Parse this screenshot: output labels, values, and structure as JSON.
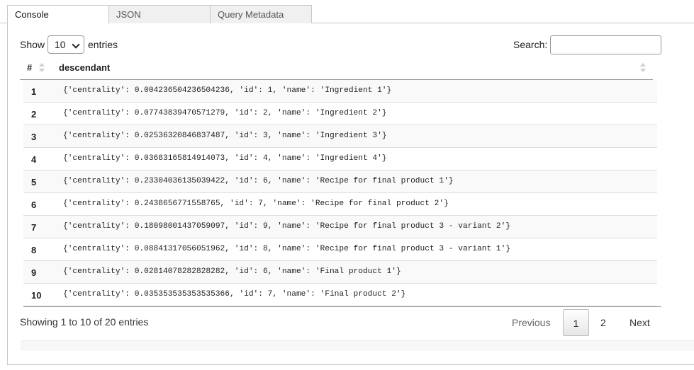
{
  "tabs": [
    {
      "label": "Console"
    },
    {
      "label": "JSON"
    },
    {
      "label": "Query Metadata"
    }
  ],
  "controls": {
    "show_label": "Show",
    "page_size": "10",
    "entries_label": "entries",
    "search_label": "Search:",
    "search_value": ""
  },
  "table": {
    "columns": [
      "#",
      "descendant"
    ],
    "rows": [
      {
        "num": "1",
        "value": "{'centrality': 0.004236504236504236, 'id': 1, 'name': 'Ingredient 1'}"
      },
      {
        "num": "2",
        "value": "{'centrality': 0.07743839470571279, 'id': 2, 'name': 'Ingredient 2'}"
      },
      {
        "num": "3",
        "value": "{'centrality': 0.02536320846837487, 'id': 3, 'name': 'Ingredient 3'}"
      },
      {
        "num": "4",
        "value": "{'centrality': 0.03683165814914073, 'id': 4, 'name': 'Ingredient 4'}"
      },
      {
        "num": "5",
        "value": "{'centrality': 0.23304036135039422, 'id': 6, 'name': 'Recipe for final product 1'}"
      },
      {
        "num": "6",
        "value": "{'centrality': 0.2438656771558765, 'id': 7, 'name': 'Recipe for final product 2'}"
      },
      {
        "num": "7",
        "value": "{'centrality': 0.18098001437059097, 'id': 9, 'name': 'Recipe for final product 3 - variant 2'}"
      },
      {
        "num": "8",
        "value": "{'centrality': 0.08841317056051962, 'id': 8, 'name': 'Recipe for final product 3 - variant 1'}"
      },
      {
        "num": "9",
        "value": "{'centrality': 0.02814078282828282, 'id': 6, 'name': 'Final product 1'}"
      },
      {
        "num": "10",
        "value": "{'centrality': 0.035353535353535366, 'id': 7, 'name': 'Final product 2'}"
      }
    ]
  },
  "footer": {
    "info": "Showing 1 to 10 of 20 entries",
    "previous": "Previous",
    "page_1": "1",
    "page_2": "2",
    "next": "Next"
  }
}
